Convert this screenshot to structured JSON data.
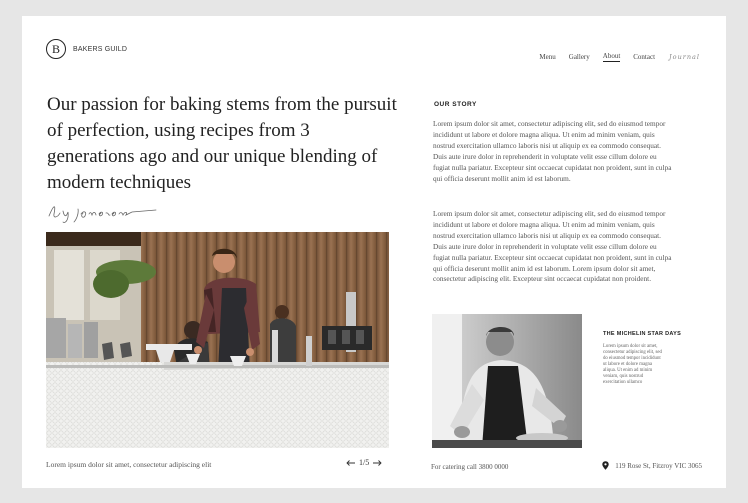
{
  "brand": {
    "logo_letter": "B",
    "name": "BAKERS GUILD"
  },
  "nav": {
    "items": [
      "Menu",
      "Gallery",
      "About",
      "Contact"
    ],
    "active": "About",
    "journal": "Journal"
  },
  "hero": {
    "headline": "Our passion for baking stems from the pursuit of perfection, using recipes from 3 generations ago and our unique blending of modern techniques",
    "signature": "by jonathon",
    "caption": "Lorem ipsum dolor sit amet, consectetur adipiscing elit",
    "pager": {
      "prev_icon": "arrow-left-icon",
      "current": "1/5",
      "next_icon": "arrow-right-icon"
    }
  },
  "story": {
    "title": "OUR STORY",
    "paragraph1": "Lorem ipsum dolor sit amet, consectetur adipiscing elit, sed do eiusmod tempor incididunt ut labore et dolore magna aliqua. Ut enim ad minim veniam, quis nostrud exercitation ullamco laboris nisi ut aliquip ex ea commodo consequat. Duis aute irure dolor in reprehenderit in voluptate velit esse cillum dolore eu fugiat nulla pariatur. Excepteur sint occaecat cupidatat non proident, sunt in culpa qui officia deserunt mollit anim id est laborum.",
    "paragraph2": "Lorem ipsum dolor sit amet, consectetur adipiscing elit, sed do eiusmod tempor incididunt ut labore et dolore magna aliqua. Ut enim ad minim veniam, quis nostrud exercitation ullamco laboris nisi ut aliquip ex ea commodo consequat. Duis aute irure dolor in reprehenderit in voluptate velit esse cillum dolore eu fugiat nulla pariatur. Excepteur sint occaecat cupidatat non proident, sunt in culpa qui officia deserunt mollit anim id est laborum. Lorem ipsum dolor sit amet, consectetur adipiscing elit. Excepteur sint occaecat cupidatat non proident."
  },
  "michelin": {
    "title": "THE MICHELIN STAR DAYS",
    "text": "Lorem ipsum dolor sit amet, consectetur adipiscing elit, sed do eiusmod tempor incididunt ut labore et dolore magna aliqua. Ut enim ad minim veniam, quis nostrud exercitation ullamco"
  },
  "footer": {
    "catering": "For catering call 3800 0000",
    "address": "119 Rose St, Fitzroy VIC 3065",
    "pin_icon": "location-pin-icon"
  }
}
